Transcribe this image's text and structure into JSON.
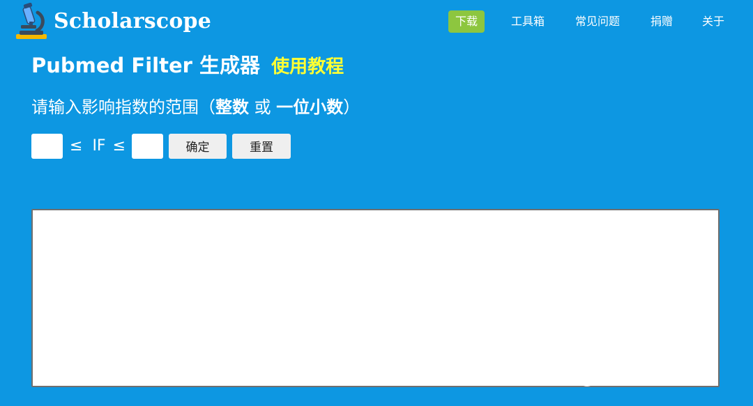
{
  "brand": {
    "name": "Scholarscope",
    "logo_icon": "microscope-icon"
  },
  "nav": {
    "items": [
      {
        "label": "下载",
        "active": true
      },
      {
        "label": "工具箱",
        "active": false
      },
      {
        "label": "常见问题",
        "active": false
      },
      {
        "label": "捐赠",
        "active": false
      },
      {
        "label": "关于",
        "active": false
      }
    ]
  },
  "main": {
    "title": "Pubmed Filter 生成器",
    "tutorial_link": "使用教程",
    "instruction": {
      "prefix": "请输入影响指数的范围（",
      "integer": "整数",
      "or": " 或 ",
      "decimal": "一位小数",
      "suffix": "）"
    },
    "range": {
      "min_value": "",
      "max_value": "",
      "le_symbol": "≤",
      "if_label": "IF"
    },
    "confirm_label": "确定",
    "reset_label": "重置",
    "result_value": ""
  },
  "watermark": "知乎 @行走的药匣子",
  "colors": {
    "background": "#0d97e2",
    "nav_active": "#8dc63f",
    "tutorial_link": "#ffff33",
    "button_bg": "#efefef"
  }
}
